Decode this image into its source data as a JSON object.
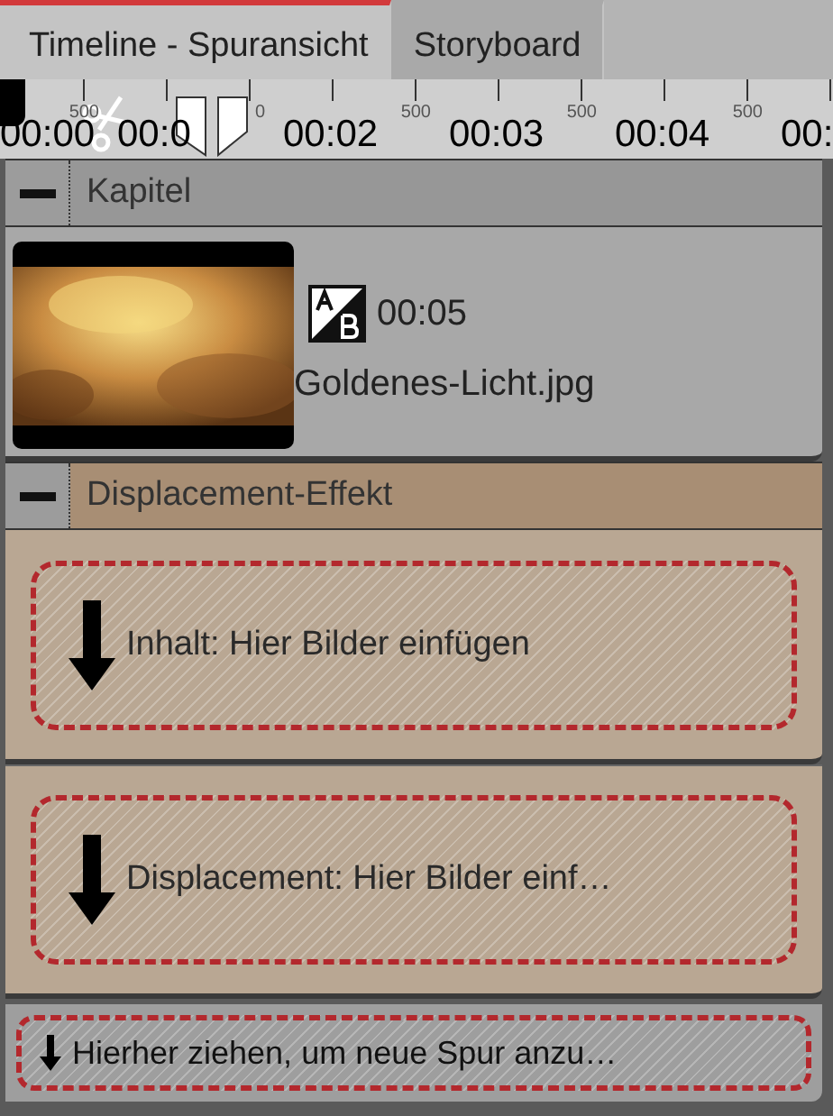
{
  "tabs": [
    {
      "label": "Timeline - Spuransicht",
      "selected": true
    },
    {
      "label": "Storyboard",
      "selected": false
    }
  ],
  "ruler": {
    "minor_labels": [
      "500",
      "0",
      "500",
      "500",
      "500"
    ],
    "time_labels": [
      "00:00",
      "00:0",
      "00:02",
      "00:03",
      "00:04",
      "00:"
    ]
  },
  "tracks": [
    {
      "kind": "chapter",
      "title": "Kapitel",
      "clip": {
        "duration": "00:05",
        "filename": "Goldenes-Licht.jpg"
      }
    },
    {
      "kind": "effect",
      "title": "Displacement-Effekt",
      "dropzones": [
        "Inhalt: Hier Bilder einfügen",
        "Displacement: Hier Bilder einf…"
      ]
    }
  ],
  "new_track_zone": "Hierher ziehen, um neue Spur anzu…"
}
